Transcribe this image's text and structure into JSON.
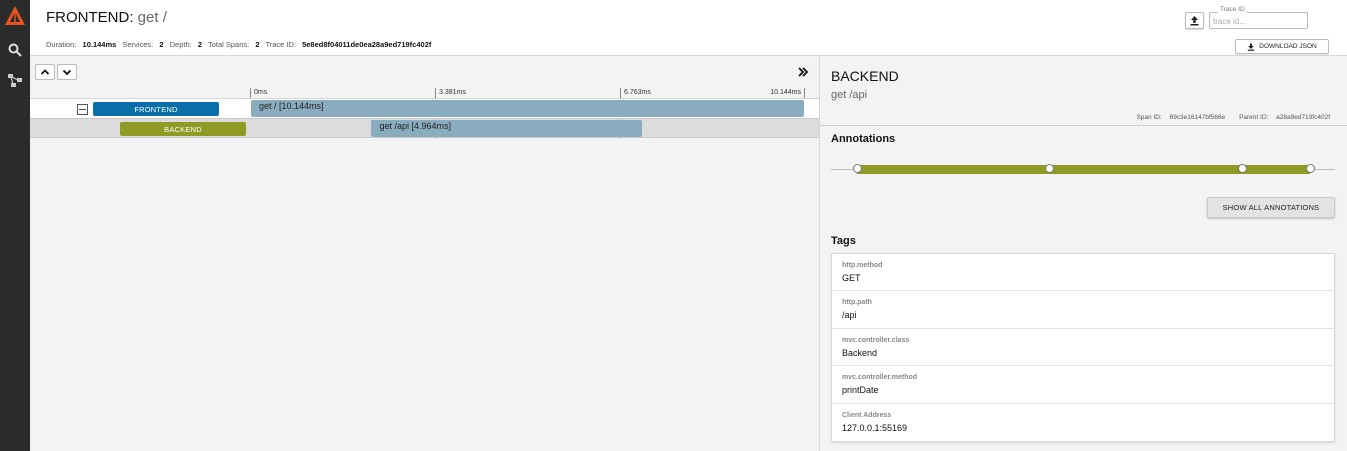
{
  "sidebar": {
    "icons": [
      "logo-icon",
      "search-icon",
      "dependencies-icon"
    ]
  },
  "header": {
    "service": "FRONTEND",
    "separator": ": ",
    "operation": "get /",
    "stats": [
      {
        "label": "Duration:",
        "value": "10.144ms"
      },
      {
        "label": "Services:",
        "value": "2"
      },
      {
        "label": "Depth:",
        "value": "2"
      },
      {
        "label": "Total Spans:",
        "value": "2"
      },
      {
        "label": "Trace ID:",
        "value": "5e8ed8f04011de0ea28a9ed719fc402f"
      }
    ],
    "trace_id_label": "Trace ID",
    "trace_id_placeholder": "trace id...",
    "download_label": "DOWNLOAD JSON"
  },
  "timeline": {
    "ticks": [
      "0ms",
      "3.381ms",
      "6.763ms",
      "10.144ms"
    ],
    "spans": [
      {
        "service": "FRONTEND",
        "label": "get / [10.144ms]",
        "color": "#0a6fa8",
        "start": 0,
        "duration": 10.144
      },
      {
        "service": "BACKEND",
        "label": "get /api [4.964ms]",
        "color": "#8f9b25",
        "start": 2.21,
        "duration": 4.964
      }
    ],
    "total_ms": 10.144
  },
  "detail": {
    "service": "BACKEND",
    "operation": "get /api",
    "span_id_label": "Span ID:",
    "span_id": "69c3e16147bf566e",
    "parent_id_label": "Parent ID:",
    "parent_id": "a28a9ed719fc402f",
    "annotations_title": "Annotations",
    "annotation_positions": [
      0,
      0.425,
      0.85,
      1.0
    ],
    "show_all_label": "SHOW ALL ANNOTATIONS",
    "tags_title": "Tags",
    "tags": [
      {
        "key": "http.method",
        "value": "GET"
      },
      {
        "key": "http.path",
        "value": "/api"
      },
      {
        "key": "mvc.controller.class",
        "value": "Backend"
      },
      {
        "key": "mvc.controller.method",
        "value": "printDate"
      },
      {
        "key": "Client Address",
        "value": "127.0.0.1:55169"
      }
    ]
  },
  "colors": {
    "accent": "#e8531f",
    "frontend": "#0a6fa8",
    "backend": "#8f9b25",
    "span_bar": "#8aacbf"
  }
}
